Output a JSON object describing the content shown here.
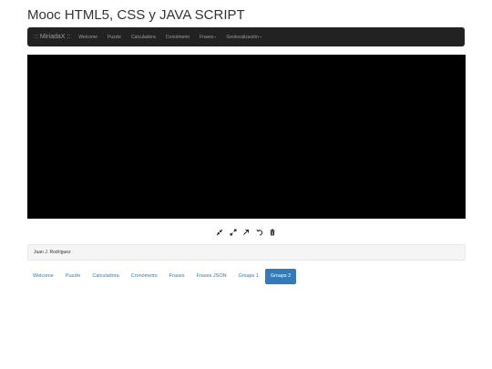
{
  "page": {
    "title": "Mooc HTML5, CSS y JAVA SCRIPT"
  },
  "navbar": {
    "brand": ":: MiriadaX ::",
    "items": [
      {
        "label": "Welcome",
        "dropdown": false
      },
      {
        "label": "Puzzle",
        "dropdown": false
      },
      {
        "label": "Calculadora",
        "dropdown": false
      },
      {
        "label": "Cronómetro",
        "dropdown": false
      },
      {
        "label": "Frases",
        "dropdown": true
      },
      {
        "label": "Geolocalización",
        "dropdown": true
      }
    ],
    "background": "#222222",
    "text_color": "#9d9d9d"
  },
  "map": {
    "background": "#000000"
  },
  "map_tools": [
    {
      "icon": "zoom-in-icon"
    },
    {
      "icon": "zoom-out-icon"
    },
    {
      "icon": "arrow-icon"
    },
    {
      "icon": "undo-icon"
    },
    {
      "icon": "trash-icon"
    }
  ],
  "footer": {
    "author": "Juan J. Rodríguez"
  },
  "pill_nav": {
    "items": [
      "Welcome",
      "Puzzle",
      "Calculadora",
      "Cronómetro",
      "Frases",
      "Frases JSON",
      "Gmaps 1",
      "Gmaps 2"
    ],
    "active": "Gmaps 2",
    "accent_color": "#337ab7"
  }
}
